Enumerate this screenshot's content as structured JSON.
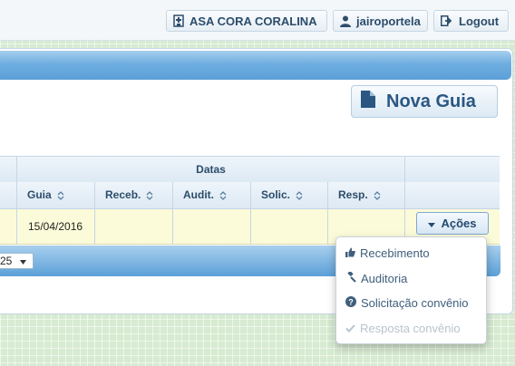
{
  "topbar": {
    "unit_label": "ASA CORA CORALINA",
    "user_label": "jairoportela",
    "logout_label": "Logout"
  },
  "actions": {
    "nova_guia_label": "Nova Guia"
  },
  "table": {
    "group_header": "Datas",
    "columns": [
      "Guia",
      "Receb.",
      "Audit.",
      "Solic.",
      "Resp."
    ],
    "rows": [
      {
        "guia": "15/04/2016",
        "receb": "",
        "audit": "",
        "solic": "",
        "resp": "",
        "acoes_label": "Ações"
      }
    ]
  },
  "pager": {
    "page_size": "25"
  },
  "acoes_menu": {
    "items": [
      {
        "label": "Recebimento",
        "icon": "thumbs-up-icon",
        "enabled": true
      },
      {
        "label": "Auditoria",
        "icon": "gavel-icon",
        "enabled": true
      },
      {
        "label": "Solicitação convênio",
        "icon": "question-circle-icon",
        "enabled": true
      },
      {
        "label": "Resposta convênio",
        "icon": "check-icon",
        "enabled": false
      }
    ]
  },
  "colors": {
    "header_blue": "#5ba0d8",
    "row_highlight": "#fbfbd9",
    "text_dark_blue": "#2c4d6b",
    "page_background": "#d6ebd1"
  }
}
